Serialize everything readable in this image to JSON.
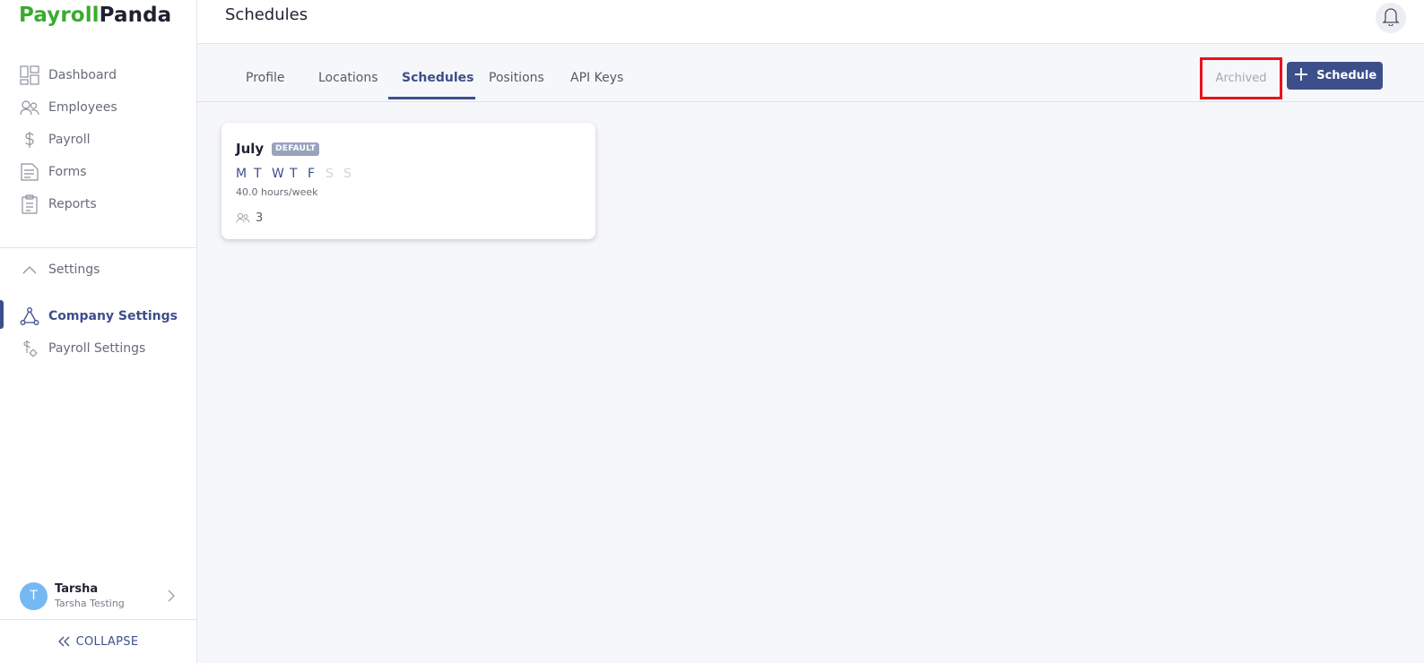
{
  "logo": {
    "part1": "Payroll",
    "part2": "Panda"
  },
  "sidebar": {
    "items": [
      {
        "label": "Dashboard",
        "icon": "dashboard-icon"
      },
      {
        "label": "Employees",
        "icon": "people-icon"
      },
      {
        "label": "Payroll",
        "icon": "dollar-icon"
      },
      {
        "label": "Forms",
        "icon": "document-icon"
      },
      {
        "label": "Reports",
        "icon": "clipboard-icon"
      }
    ],
    "settings_label": "Settings",
    "settings_items": [
      {
        "label": "Company Settings",
        "icon": "network-icon",
        "active": true
      },
      {
        "label": "Payroll Settings",
        "icon": "payroll-gear-icon",
        "active": false
      }
    ],
    "user": {
      "initial": "T",
      "name": "Tarsha",
      "company": "Tarsha Testing"
    },
    "collapse_label": "COLLAPSE"
  },
  "header": {
    "title": "Schedules"
  },
  "tabs": [
    {
      "label": "Profile"
    },
    {
      "label": "Locations"
    },
    {
      "label": "Schedules",
      "active": true
    },
    {
      "label": "Positions"
    },
    {
      "label": "API Keys"
    }
  ],
  "actions": {
    "archived_label": "Archived",
    "add_label": "Schedule"
  },
  "schedule_card": {
    "name": "July",
    "badge": "DEFAULT",
    "days": [
      {
        "letter": "M",
        "on": true
      },
      {
        "letter": "T",
        "on": true
      },
      {
        "letter": "W",
        "on": true
      },
      {
        "letter": "T",
        "on": true
      },
      {
        "letter": "F",
        "on": true
      },
      {
        "letter": "S",
        "on": false
      },
      {
        "letter": "S",
        "on": false
      }
    ],
    "hours": "40.0 hours/week",
    "employee_count": "3"
  },
  "colors": {
    "brand_green": "#3bab2f",
    "primary": "#3d4f8a",
    "highlight": "#e8131c"
  }
}
